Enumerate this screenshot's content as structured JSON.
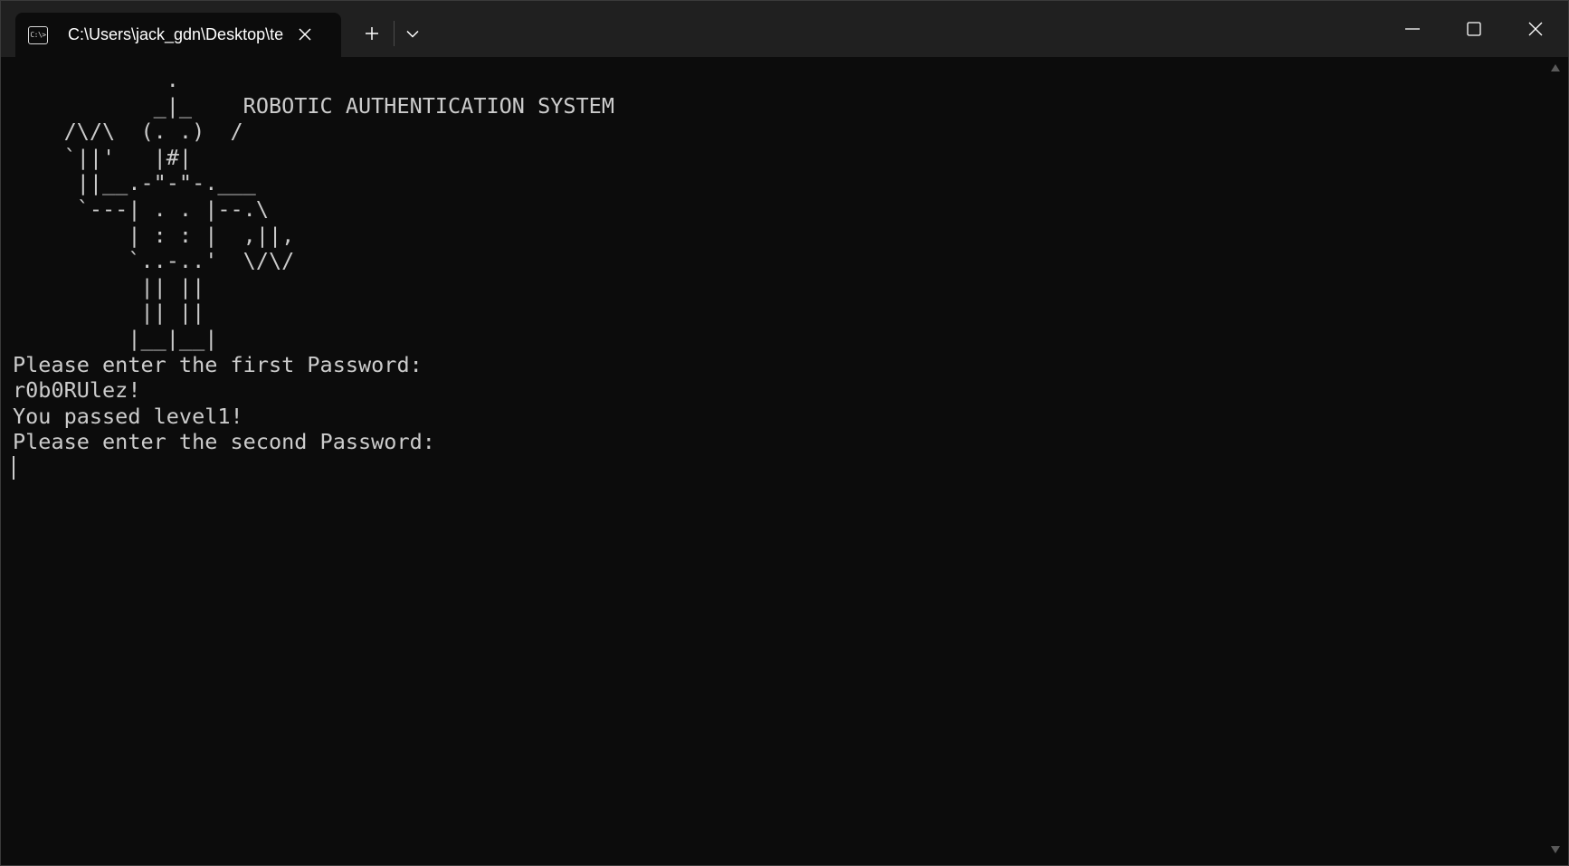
{
  "tab": {
    "icon_label": "C:\\>",
    "title": "C:\\Users\\jack_gdn\\Desktop\\te"
  },
  "icons": {
    "terminal": "cmd-icon",
    "tab_close": "close-icon",
    "new_tab": "plus-icon",
    "dropdown": "chevron-down-icon",
    "minimize": "minimize-icon",
    "maximize": "maximize-icon",
    "close": "close-icon",
    "scroll_up": "triangle-up-icon",
    "scroll_down": "triangle-down-icon"
  },
  "terminal": {
    "ascii_art": "            .\n           _|_    ROBOTIC AUTHENTICATION SYSTEM\n    /\\/\\  (. .)  /\n    `||'   |#|\n     ||__.-\"-\"-.___\n     `---| . . |--.\\\n         | : : |  ,||,\n         `..-..'  \\/\\/\n          || ||\n          || ||\n         |__|__|",
    "lines": [
      "Please enter the first Password:",
      "r0b0RUlez!",
      "You passed level1!",
      "Please enter the second Password:"
    ]
  },
  "colors": {
    "background": "#0c0c0c",
    "titlebar": "#202020",
    "text": "#cccccc"
  }
}
